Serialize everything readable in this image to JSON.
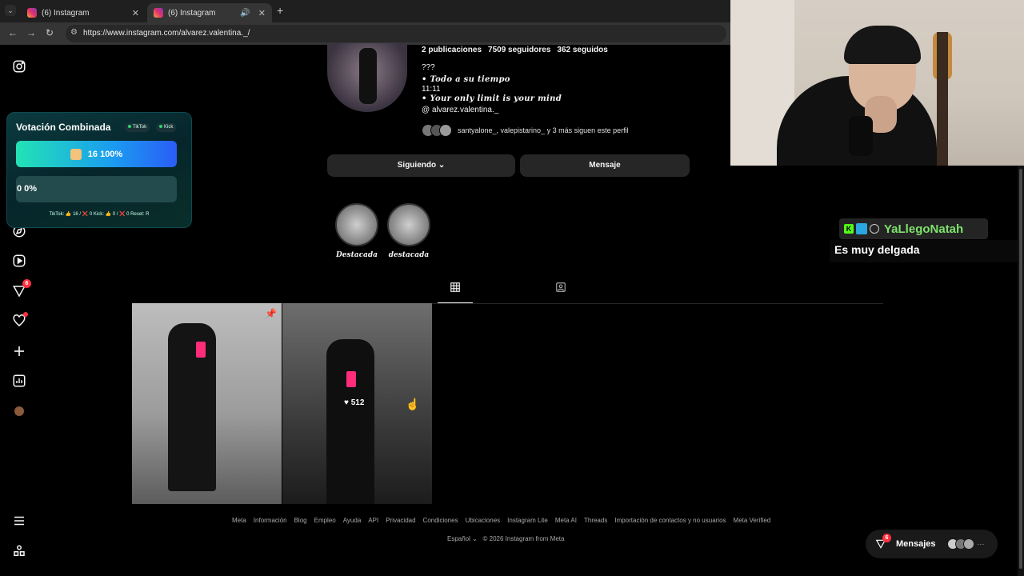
{
  "browser": {
    "tabs": [
      {
        "title": "(6) Instagram"
      },
      {
        "title": "(6) Instagram"
      }
    ],
    "url": "https://www.instagram.com/alvarez.valentina._/"
  },
  "profile": {
    "posts": "2 publicaciones",
    "followers": "7509 seguidores",
    "following": "362 seguidos",
    "bio_lines": [
      "???",
      "• Todo a su tiempo",
      "11:11",
      "• Your only limit is your mind"
    ],
    "threads_handle": "alvarez.valentina._",
    "followed_by": "santyalone_, valepistarino_ y 3 más siguen este perfil",
    "following_button": "Siguiendo ⌄",
    "message_button": "Mensaje",
    "highlights": [
      {
        "label": "Destacada"
      },
      {
        "label": "destacada"
      }
    ],
    "post_likes": "512"
  },
  "nav": {
    "notification_badge": "6"
  },
  "vote": {
    "title": "Votación Combinada",
    "tag_tiktok": "TikTok",
    "tag_kick": "Kick",
    "option1": "16  100%",
    "option2": "0  0%",
    "footer": "TikTok: 👍 16 / ❌ 0    Kick: 👍 0 / ❌ 0    Reset: R"
  },
  "chat": {
    "username": "YaLlegoNatah",
    "message": "Es muy delgada"
  },
  "footer": {
    "links": [
      "Meta",
      "Información",
      "Blog",
      "Empleo",
      "Ayuda",
      "API",
      "Privacidad",
      "Condiciones",
      "Ubicaciones",
      "Instagram Lite",
      "Meta AI",
      "Threads",
      "Importación de contactos y no usuarios",
      "Meta Verified"
    ],
    "language": "Español ⌄",
    "copyright": "© 2026 Instagram from Meta"
  },
  "messages": {
    "label": "Mensajes",
    "badge": "6"
  },
  "colors": {
    "background": "#000000",
    "button": "#262626",
    "accent_red": "#ff3040",
    "chat_name": "#7ee36b"
  }
}
